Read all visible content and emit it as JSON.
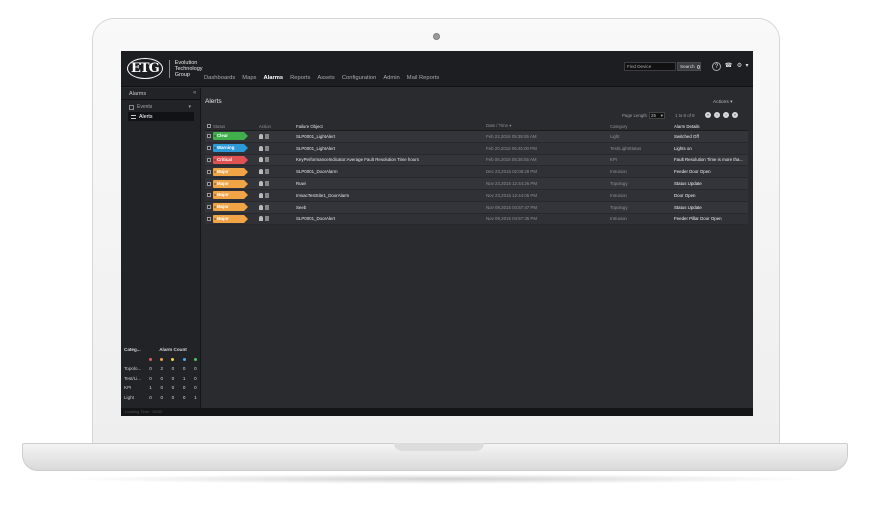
{
  "brand": {
    "mark": "ETG",
    "name_lines": [
      "Evolution",
      "Technology",
      "Group"
    ]
  },
  "nav": [
    {
      "label": "Dashboards",
      "active": false
    },
    {
      "label": "Maps",
      "active": false
    },
    {
      "label": "Alarms",
      "active": true
    },
    {
      "label": "Reports",
      "active": false
    },
    {
      "label": "Assets",
      "active": false
    },
    {
      "label": "Configuration",
      "active": false
    },
    {
      "label": "Admin",
      "active": false
    },
    {
      "label": "Mail Reports",
      "active": false
    }
  ],
  "search": {
    "placeholder": "Find Device",
    "button_label": "Search"
  },
  "toolbar_icons": [
    "help-icon",
    "phone-icon",
    "settings-icon"
  ],
  "sidebar": {
    "title": "Alarms",
    "items": [
      {
        "label": "Events"
      },
      {
        "label": "Alerts",
        "selected": true
      }
    ]
  },
  "alarm_count": {
    "header_category": "Categ...",
    "header_counts": "Alarm Count",
    "severity_colors": [
      "#e05b5b",
      "#f0a14a",
      "#f4d24a",
      "#4aa8e8",
      "#49c85a"
    ],
    "rows": [
      {
        "category": "Topolo...",
        "counts": [
          "0",
          "2",
          "0",
          "0",
          "0"
        ]
      },
      {
        "category": "Test/Li...",
        "counts": [
          "0",
          "0",
          "0",
          "1",
          "0"
        ]
      },
      {
        "category": "KPI",
        "counts": [
          "1",
          "0",
          "0",
          "0",
          "0"
        ]
      },
      {
        "category": "Light",
        "counts": [
          "0",
          "0",
          "0",
          "0",
          "1"
        ]
      }
    ]
  },
  "alerts": {
    "title": "Alerts",
    "actions_label": "Actions",
    "pager": {
      "length_label": "Page Length",
      "length_value": "25",
      "count_label": "1 to 8 of 8"
    },
    "columns": [
      "Status",
      "Action",
      "Failure Object",
      "Date / Time",
      "Category",
      "Alarm Details"
    ],
    "rows": [
      {
        "severity": "Clear",
        "color": "#3fae4b",
        "object": "SLP0001_LightAlert",
        "datetime": "Feb 22,2016 05:35:55 AM",
        "category": "Light",
        "details": "Switched Off"
      },
      {
        "severity": "Warning",
        "color": "#2d9ad8",
        "object": "SLP0001_LightAlert",
        "datetime": "Feb 20,2016 05:45:00 PM",
        "category": "Test/LightStatus",
        "details": "Lights on"
      },
      {
        "severity": "Critical",
        "color": "#e05252",
        "object": "KeyPerformanceIndicator:Average Fault Resolution Time hours",
        "datetime": "Feb 06,2016 05:35:55 AM",
        "category": "KPI",
        "details": "Fault Resolution Time is more tha..."
      },
      {
        "severity": "Major",
        "color": "#f0a445",
        "object": "SLP0001_DoorAlarm",
        "datetime": "Dec 23,2015 02:08:28 PM",
        "category": "Intrusion",
        "details": "Feeder Door Open"
      },
      {
        "severity": "Major",
        "color": "#f0a445",
        "object": "Ruwi",
        "datetime": "Nov 23,2015 12:44:26 PM",
        "category": "Topology",
        "details": "Status Update"
      },
      {
        "severity": "Major",
        "color": "#f0a445",
        "object": "ImsacTestSite1_DoorAlarm",
        "datetime": "Nov 23,2015 12:44:05 PM",
        "category": "Intrusion",
        "details": "Door Open"
      },
      {
        "severity": "Major",
        "color": "#f0a445",
        "object": "Seeb",
        "datetime": "Nov 09,2015 04:57:47 PM",
        "category": "Topology",
        "details": "Status Update"
      },
      {
        "severity": "Major",
        "color": "#f0a445",
        "object": "SLP0001_DoorAlert",
        "datetime": "Nov 09,2015 04:57:36 PM",
        "category": "Intrusion",
        "details": "Feeder Pillar Door Open"
      }
    ]
  },
  "status_bar": "Loading Time : 00:00"
}
